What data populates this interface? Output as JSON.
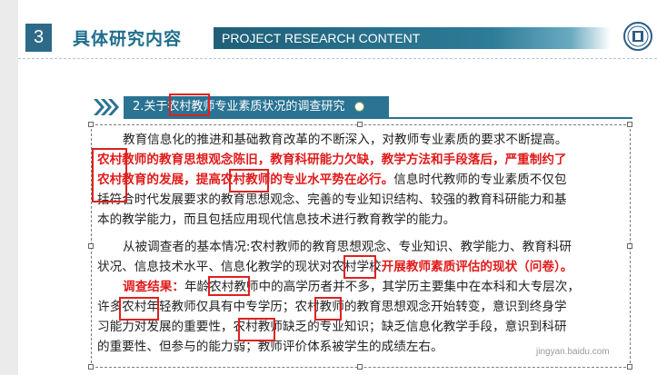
{
  "header": {
    "section_number": "3",
    "section_title": "具体研究内容",
    "banner_text": "PROJECT RESEARCH CONTENT",
    "accent_color": "#2d6a88"
  },
  "subheading": {
    "text": "2.关于农村教师专业素质状况的调查研究"
  },
  "body": {
    "lines": [
      {
        "parts": [
          "教育信息化的推进和基础教育改革的不断深入，对教师专业素质的要求不断提高。"
        ]
      },
      {
        "parts": [
          "农村教师的教育思想观念陈旧，教育科研能力欠缺，教学方法和手段落后，严重制约了"
        ]
      },
      {
        "parts": [
          "农村教育的发展，提高农村教师的专业水平势在必行。",
          "信息时代教师的专业素质不仅包"
        ]
      },
      {
        "parts": [
          "括符合时代发展要求的教育思想观念、完善的专业知识结构、较强的教育科研能力和基"
        ]
      },
      {
        "parts": [
          "本的教学能力，而且包括应用现代信息技术进行教育教学的能力。"
        ]
      },
      {
        "parts": [
          "从被调查者的基本情况:农村教师的教育思想观念、专业知识、教学能力、教育科研"
        ]
      },
      {
        "parts": [
          "状况、信息技术水平、信息化教学的现状对农村学校",
          "开展教师素质评估的现状（问卷）。"
        ]
      },
      {
        "parts": [
          "调查结果：",
          "年龄农村教师中的高学历者并不多，其学历主要集中在本科和大专层次，"
        ]
      },
      {
        "parts": [
          "许多农村年轻教师仅具有中专学历；农村教师的教育思想观念开始转变，意识到终身学"
        ]
      },
      {
        "parts": [
          "习能力对发展的重要性，农村教师缺乏的专业知识；缺乏信息化教学手段，意识到科研"
        ]
      },
      {
        "parts": [
          "的重要性、但参与的能力弱；教师评价体系被学生的成绩左右。"
        ]
      }
    ]
  },
  "watermark": "jingyan.baidu.com"
}
